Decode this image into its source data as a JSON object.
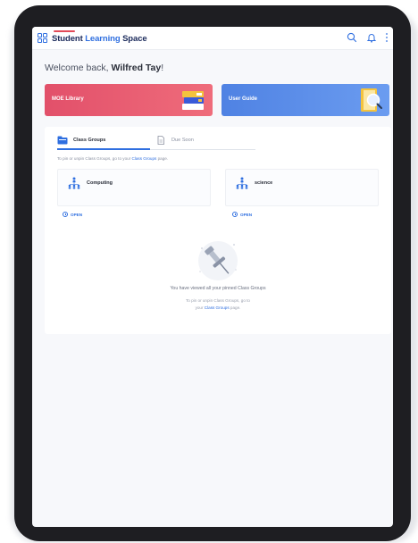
{
  "header": {
    "logo_part1": "Student ",
    "logo_part2": "Learning",
    "logo_part3": " Space",
    "icons": [
      "grid-icon",
      "search-icon",
      "bell-icon",
      "more-vertical-icon"
    ]
  },
  "welcome": {
    "prefix": "Welcome back, ",
    "name": "Wilfred Tay",
    "suffix": "!"
  },
  "banners": {
    "moe_library": "MOE Library",
    "user_guide": "User Guide"
  },
  "tabs": {
    "class_groups": "Class Groups",
    "due_soon": "Due Soon"
  },
  "hint": {
    "text": "To pin or unpin Class Groups, go to your ",
    "link": "Class Groups",
    "suffix": " page."
  },
  "groups": [
    {
      "name": "Computing",
      "open_label": "OPEN"
    },
    {
      "name": "science",
      "open_label": "OPEN"
    }
  ],
  "empty_state": {
    "title": "You have viewed all your pinned Class Groups",
    "line1": "To pin or unpin Class Groups, go to",
    "line2_prefix": "your ",
    "line2_link": "Class Groups",
    "line2_suffix": " page."
  },
  "colors": {
    "accent": "#2f6fe0",
    "moe_banner": "#e2506a",
    "guide_banner": "#4f82e3",
    "brand_red": "#e24a57"
  }
}
